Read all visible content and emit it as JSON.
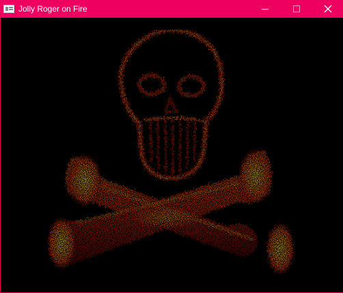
{
  "window": {
    "title": "Jolly Roger on Fire",
    "accent_color": "#EE0060",
    "icons": {
      "app": "app-window-icon",
      "minimize": "minimize-icon",
      "maximize": "maximize-icon",
      "close": "close-icon"
    }
  },
  "content": {
    "background_color": "#000000",
    "fire_colors": [
      "#7a0000",
      "#c41a00",
      "#ff4a00",
      "#ff9a00",
      "#ffe84a"
    ]
  }
}
